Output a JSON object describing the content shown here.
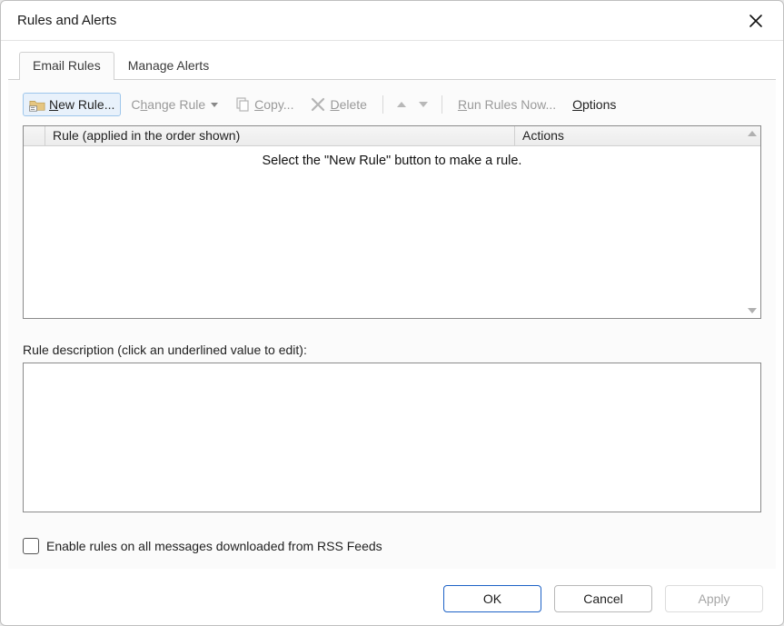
{
  "window": {
    "title": "Rules and Alerts"
  },
  "tabs": [
    {
      "label": "Email Rules",
      "active": true
    },
    {
      "label": "Manage Alerts",
      "active": false
    }
  ],
  "toolbar": {
    "new_rule": "New Rule...",
    "change_rule": "Change Rule",
    "copy": "Copy...",
    "delete": "Delete",
    "run_rules_now": "Run Rules Now...",
    "options": "Options"
  },
  "list": {
    "header_rule": "Rule (applied in the order shown)",
    "header_actions": "Actions",
    "empty_text": "Select the \"New Rule\" button to make a rule."
  },
  "description": {
    "label": "Rule description (click an underlined value to edit):"
  },
  "checkbox": {
    "label": "Enable rules on all messages downloaded from RSS Feeds",
    "checked": false
  },
  "buttons": {
    "ok": "OK",
    "cancel": "Cancel",
    "apply": "Apply"
  }
}
